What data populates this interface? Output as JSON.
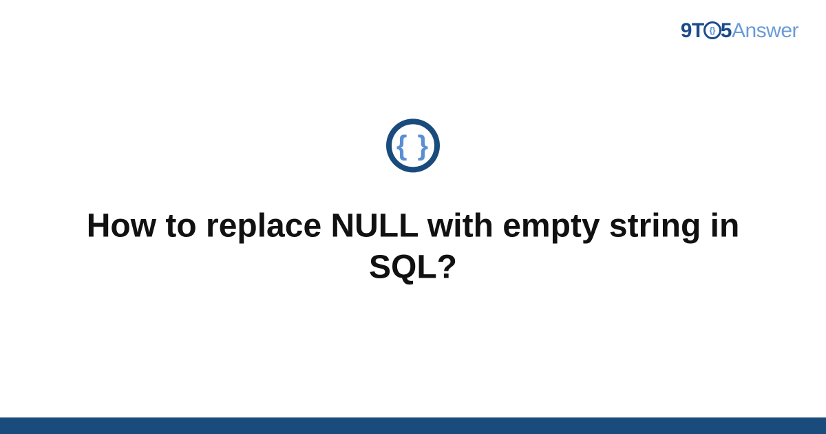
{
  "brand": {
    "part1": "9T",
    "part2_inner": "{}",
    "part3": "5",
    "part4": "Answer"
  },
  "icon": {
    "glyph": "{ }"
  },
  "question": {
    "title": "How to replace NULL with empty string in SQL?"
  }
}
